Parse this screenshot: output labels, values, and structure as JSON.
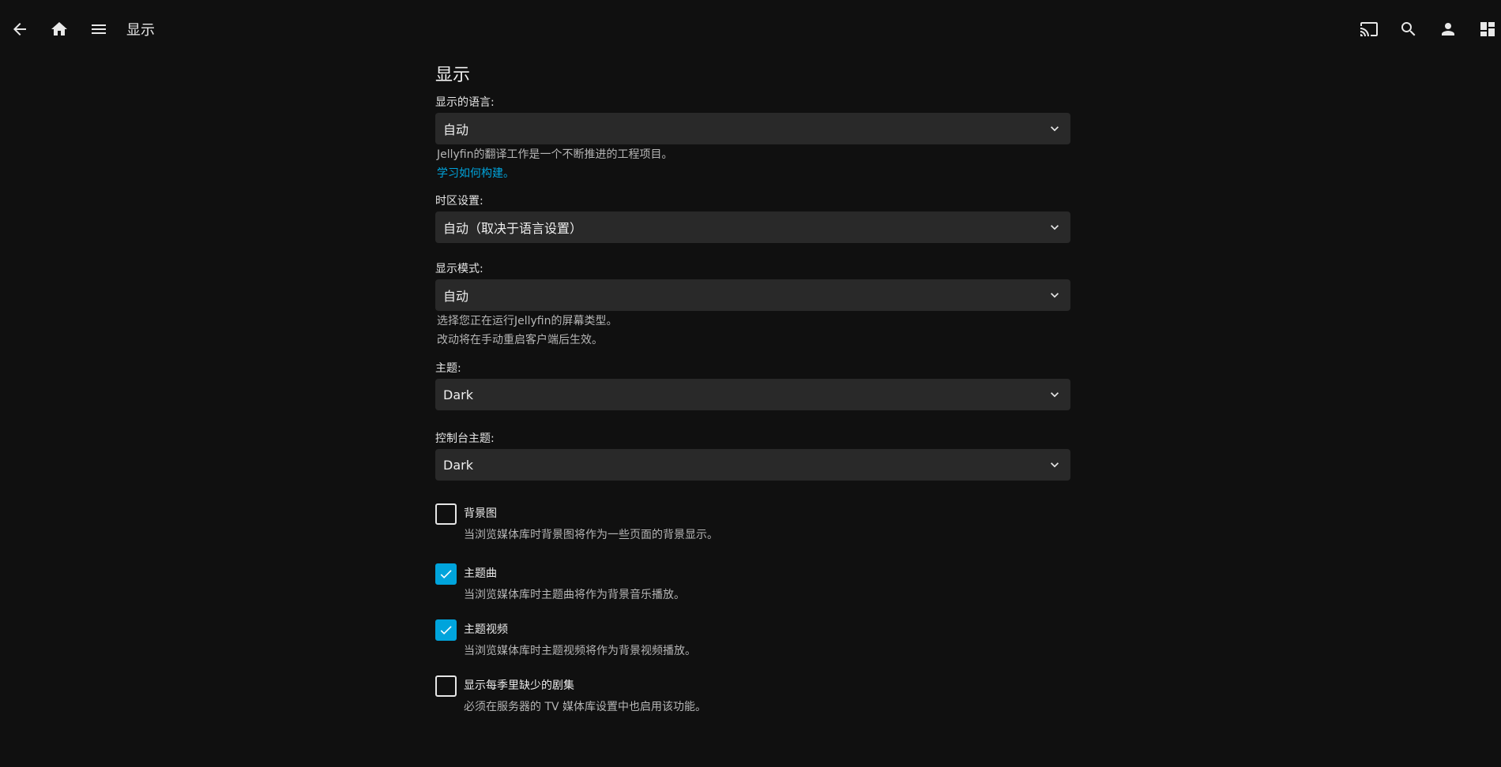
{
  "header": {
    "title": "显示",
    "icons": [
      "back-arrow-icon",
      "home-icon",
      "menu-icon",
      "cast-icon",
      "search-icon",
      "user-icon",
      "dashboard-icon"
    ]
  },
  "page": {
    "heading": "显示"
  },
  "fields": {
    "language": {
      "label": "显示的语言:",
      "value": "自动",
      "help": "Jellyfin的翻译工作是一个不断推进的工程项目。",
      "link": "学习如何构建。"
    },
    "timezone": {
      "label": "时区设置:",
      "value": "自动（取决于语言设置）"
    },
    "display_mode": {
      "label": "显示模式:",
      "value": "自动",
      "help1": "选择您正在运行Jellyfin的屏幕类型。",
      "help2": "改动将在手动重启客户端后生效。"
    },
    "theme": {
      "label": "主题:",
      "value": "Dark"
    },
    "dashboard_theme": {
      "label": "控制台主题:",
      "value": "Dark"
    }
  },
  "checkboxes": [
    {
      "label": "背景图",
      "description": "当浏览媒体库时背景图将作为一些页面的背景显示。",
      "checked": false
    },
    {
      "label": "主题曲",
      "description": "当浏览媒体库时主题曲将作为背景音乐播放。",
      "checked": true
    },
    {
      "label": "主题视频",
      "description": "当浏览媒体库时主题视频将作为背景视频播放。",
      "checked": true
    },
    {
      "label": "显示每季里缺少的剧集",
      "description": "必须在服务器的 TV 媒体库设置中也启用该功能。",
      "checked": false
    }
  ],
  "colors": {
    "background": "#101010",
    "select_bg": "#292929",
    "accent": "#00a4dc"
  }
}
